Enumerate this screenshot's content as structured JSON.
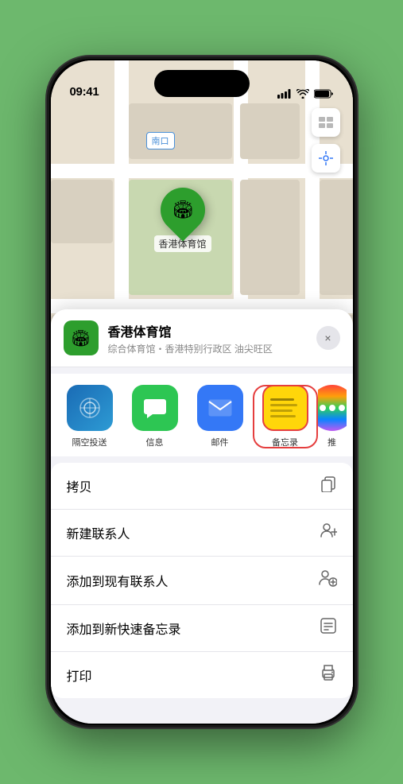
{
  "status_bar": {
    "time": "09:41",
    "signal": "●●●●",
    "wifi": "wifi",
    "battery": "battery"
  },
  "map": {
    "label_tag": "南口",
    "marker_label": "香港体育馆",
    "controls": [
      "map_type",
      "location"
    ]
  },
  "location_sheet": {
    "title": "香港体育馆",
    "subtitle": "综合体育馆・香港特别行政区 油尖旺区",
    "close_label": "×"
  },
  "share_items": [
    {
      "id": "airdrop",
      "label": "隔空投送",
      "type": "airdrop"
    },
    {
      "id": "messages",
      "label": "信息",
      "type": "messages"
    },
    {
      "id": "mail",
      "label": "邮件",
      "type": "mail"
    },
    {
      "id": "notes",
      "label": "备忘录",
      "type": "notes"
    },
    {
      "id": "more",
      "label": "推",
      "type": "more"
    }
  ],
  "actions": [
    {
      "label": "拷贝",
      "icon": "copy"
    },
    {
      "label": "新建联系人",
      "icon": "person-add"
    },
    {
      "label": "添加到现有联系人",
      "icon": "person-plus"
    },
    {
      "label": "添加到新快速备忘录",
      "icon": "note-add"
    },
    {
      "label": "打印",
      "icon": "print"
    }
  ],
  "home_indicator": true
}
